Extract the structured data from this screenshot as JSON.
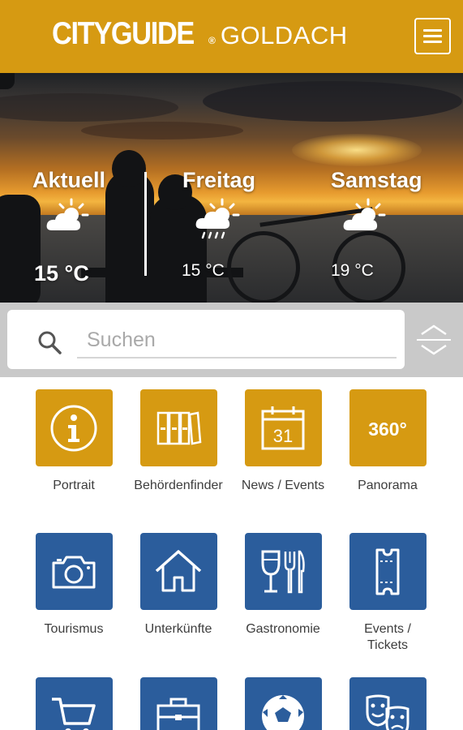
{
  "header": {
    "brand": "CITYGUIDE",
    "brand_mark": "®",
    "city": "GOLDACH",
    "menu_icon": "hamburger-menu-icon"
  },
  "weather": [
    {
      "day": "Aktuell",
      "temp": "15 °C",
      "icon": "partly-cloudy-icon"
    },
    {
      "day": "Freitag",
      "temp": "15 °C",
      "icon": "cloud-rain-sun-icon"
    },
    {
      "day": "Samstag",
      "temp": "19 °C",
      "icon": "partly-cloudy-icon"
    }
  ],
  "search": {
    "placeholder": "Suchen",
    "value": ""
  },
  "colors": {
    "brand_gold": "#d69a12",
    "tile_gold": "#d69a12",
    "tile_blue": "#2b5d9c",
    "search_bg": "#c9c9c9"
  },
  "tiles": [
    {
      "label": "Portrait",
      "icon": "info-icon",
      "color": "gold"
    },
    {
      "label": "Behördenfinder",
      "icon": "binders-icon",
      "color": "gold"
    },
    {
      "label": "News / Events",
      "icon": "calendar-icon",
      "color": "gold",
      "icon_text": "31"
    },
    {
      "label": "Panorama",
      "icon": "panorama-360-icon",
      "color": "gold",
      "icon_text": "360°"
    },
    {
      "label": "Tourismus",
      "icon": "camera-icon",
      "color": "blue"
    },
    {
      "label": "Unterkünfte",
      "icon": "house-icon",
      "color": "blue"
    },
    {
      "label": "Gastronomie",
      "icon": "wine-cutlery-icon",
      "color": "blue"
    },
    {
      "label": "Events / Tickets",
      "icon": "ticket-icon",
      "color": "blue"
    },
    {
      "label": "",
      "icon": "shopping-cart-icon",
      "color": "blue"
    },
    {
      "label": "",
      "icon": "briefcase-icon",
      "color": "blue"
    },
    {
      "label": "",
      "icon": "soccer-ball-icon",
      "color": "blue"
    },
    {
      "label": "",
      "icon": "theater-masks-icon",
      "color": "blue"
    }
  ]
}
